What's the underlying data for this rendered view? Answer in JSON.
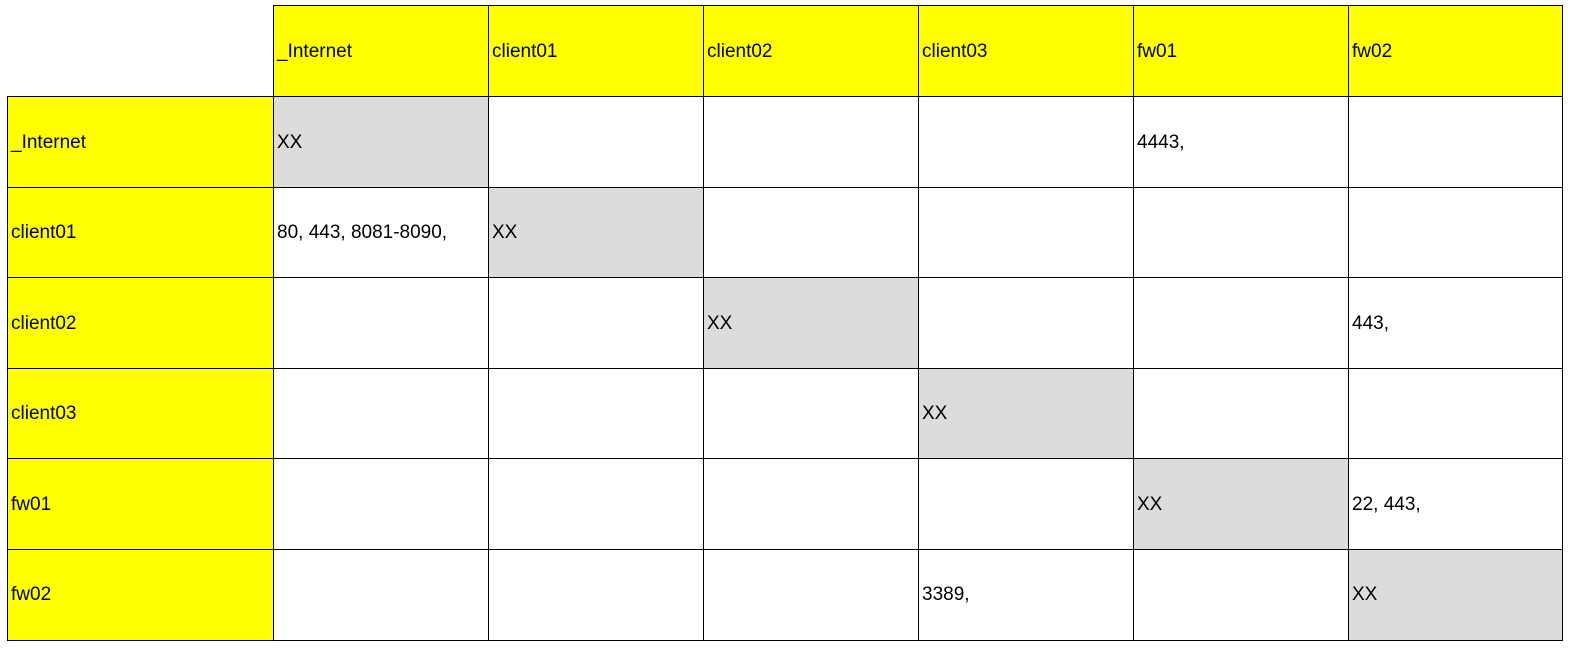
{
  "matrix": {
    "columns": [
      "_Internet",
      "client01",
      "client02",
      "client03",
      "fw01",
      "fw02"
    ],
    "rows": [
      {
        "label": "_Internet",
        "cells": [
          "XX",
          "",
          "",
          "",
          "4443,",
          ""
        ]
      },
      {
        "label": "client01",
        "cells": [
          "80, 443, 8081-8090,",
          "XX",
          "",
          "",
          "",
          ""
        ]
      },
      {
        "label": "client02",
        "cells": [
          "",
          "",
          "XX",
          "",
          "",
          "443,"
        ]
      },
      {
        "label": "client03",
        "cells": [
          "",
          "",
          "",
          "XX",
          "",
          ""
        ]
      },
      {
        "label": "fw01",
        "cells": [
          "",
          "",
          "",
          "",
          "XX",
          "22, 443,"
        ]
      },
      {
        "label": "fw02",
        "cells": [
          "",
          "",
          "",
          "3389,",
          "",
          "XX"
        ]
      }
    ],
    "colors": {
      "header_bg": "#ffff00",
      "diagonal_bg": "#dcdcdc",
      "cell_bg": "#ffffff",
      "grid": "#000000"
    }
  }
}
